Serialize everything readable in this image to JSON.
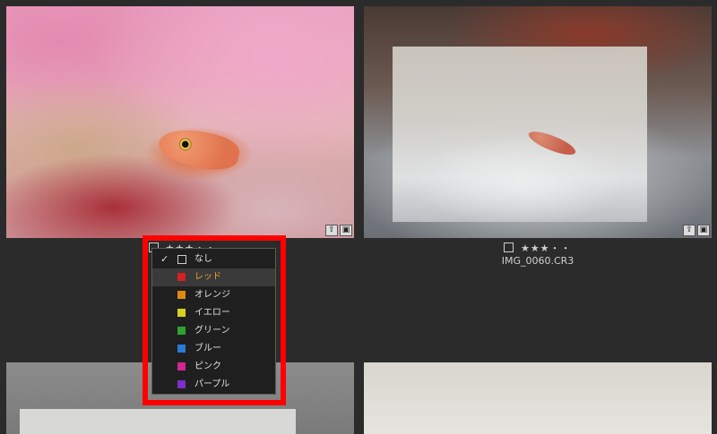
{
  "photos": [
    {
      "id": "photo-1"
    },
    {
      "id": "photo-2",
      "rating_stars": "★★★・・",
      "filename": "IMG_0060.CR3"
    }
  ],
  "photo1_rating_partial": "★★★・・",
  "overlay_icons": [
    "export-icon",
    "frame-icon"
  ],
  "color_menu": {
    "items": [
      {
        "label": "なし",
        "color": null,
        "checked": true
      },
      {
        "label": "レッド",
        "color": "#d42020",
        "active": true
      },
      {
        "label": "オレンジ",
        "color": "#e08a10"
      },
      {
        "label": "イエロー",
        "color": "#d8d020"
      },
      {
        "label": "グリーン",
        "color": "#30a030"
      },
      {
        "label": "ブルー",
        "color": "#2a7ad8"
      },
      {
        "label": "ピンク",
        "color": "#d02890"
      },
      {
        "label": "パープル",
        "color": "#7a30c8"
      }
    ]
  },
  "colors": {
    "highlight": "#ff0000",
    "background": "#2b2b2b",
    "active_text": "#f0a030"
  }
}
